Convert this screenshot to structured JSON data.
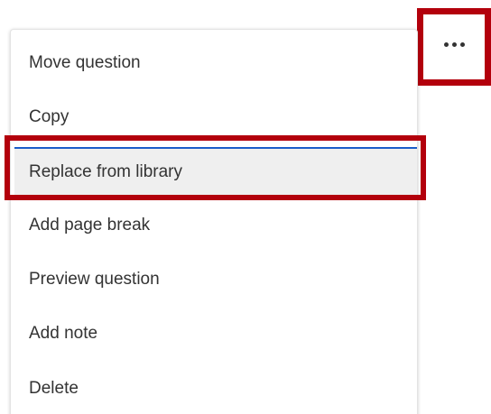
{
  "more_button": {
    "icon": "more-horizontal-icon"
  },
  "menu": {
    "items": [
      {
        "label": "Move question"
      },
      {
        "label": "Copy"
      },
      {
        "label": "Replace from library"
      },
      {
        "label": "Add page break"
      },
      {
        "label": "Preview question"
      },
      {
        "label": "Add note"
      },
      {
        "label": "Delete"
      }
    ]
  },
  "colors": {
    "highlight": "#b3000c",
    "active_item_bg": "#efefef",
    "focus_border": "#1a5dc9",
    "text": "#333333"
  }
}
